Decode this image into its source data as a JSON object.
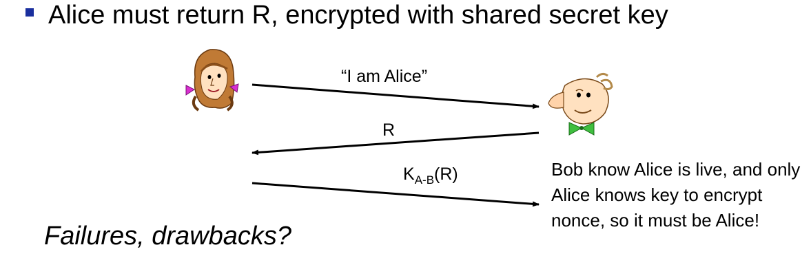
{
  "heading": {
    "text": "Alice must return R, encrypted with shared secret key"
  },
  "messages": [
    {
      "label": "“I am Alice”",
      "direction": "alice-to-bob"
    },
    {
      "label": "R",
      "direction": "bob-to-alice"
    },
    {
      "label_main": "K",
      "label_sub": "A-B",
      "label_tail": "(R)",
      "direction": "alice-to-bob"
    }
  ],
  "note": {
    "text": "Bob know Alice is live, and only Alice knows key to encrypt nonce, so it must be Alice!"
  },
  "question": {
    "text": "Failures, drawbacks?"
  },
  "colors": {
    "bullet": "#1a2f9e",
    "arrow": "#000000",
    "alice_hair": "#b5702a",
    "alice_bow": "#d82fd0",
    "bob_tie": "#3fbf3f"
  },
  "icons": {
    "alice": "alice-cartoon-icon",
    "bob": "bob-cartoon-icon"
  }
}
